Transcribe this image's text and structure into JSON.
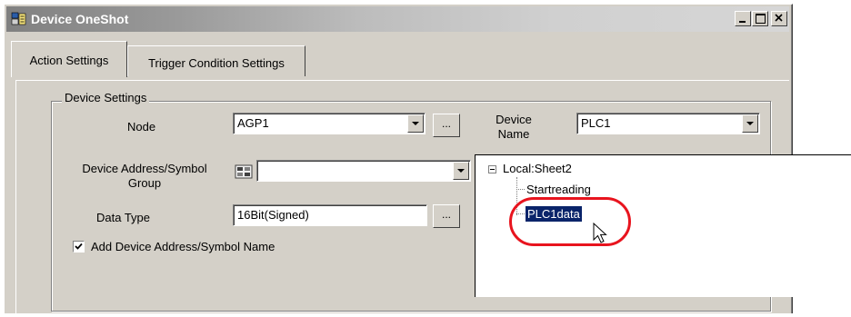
{
  "window": {
    "title": "Device OneShot",
    "title_icon": "device-oneshot-icon",
    "controls": [
      "minimize-icon",
      "maximize-icon",
      "close-icon"
    ]
  },
  "tabs": [
    {
      "label": "Action Settings",
      "active": true
    },
    {
      "label": "Trigger Condition Settings",
      "active": false
    }
  ],
  "device_settings": {
    "group_label": "Device Settings",
    "node_label": "Node",
    "node_value": "AGP1",
    "browse_label": "...",
    "device_name_label_line1": "Device",
    "device_name_label_line2": "Name",
    "device_name_value": "PLC1",
    "address_label_line1": "Device Address/Symbol",
    "address_label_line2": "Group",
    "address_value": "",
    "data_type_label": "Data Type",
    "data_type_value": "16Bit(Signed)",
    "add_name_label": "Add Device Address/Symbol Name",
    "add_name_checked": true
  },
  "tree": {
    "root": "Local:Sheet2",
    "items": [
      "Startreading",
      "PLC1data"
    ],
    "selected": "PLC1data"
  },
  "colors": {
    "highlight_ring": "#e8141e",
    "selection": "#0a246a",
    "face": "#d4d0c8"
  }
}
